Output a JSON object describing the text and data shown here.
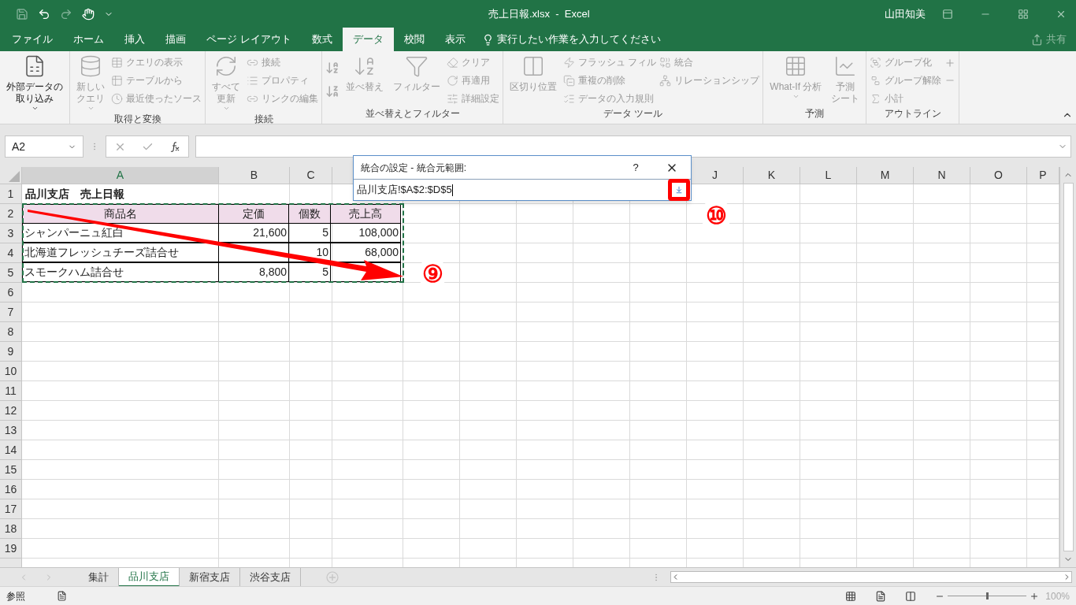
{
  "title_bar": {
    "title": "売上日報.xlsx  -  Excel",
    "user": "山田知美"
  },
  "tabs": [
    {
      "label": "ファイル",
      "selected": false
    },
    {
      "label": "ホーム",
      "selected": false
    },
    {
      "label": "挿入",
      "selected": false
    },
    {
      "label": "描画",
      "selected": false
    },
    {
      "label": "ページ レイアウト",
      "selected": false
    },
    {
      "label": "数式",
      "selected": false
    },
    {
      "label": "データ",
      "selected": true
    },
    {
      "label": "校閲",
      "selected": false
    },
    {
      "label": "表示",
      "selected": false
    }
  ],
  "tell_me": "実行したい作業を入力してください",
  "share": "共有",
  "ribbon_groups": [
    {
      "items": [
        {
          "kind": "large",
          "lines": [
            "外部データの",
            "取り込み"
          ],
          "disabled": false,
          "dropdown": true
        }
      ]
    },
    {
      "label": "取得と変換",
      "items": [
        {
          "kind": "large",
          "lines": [
            "新しい",
            "クエリ"
          ],
          "disabled": true,
          "dropdown": true
        },
        {
          "kind": "stack",
          "items": [
            {
              "label": "クエリの表示",
              "disabled": true
            },
            {
              "label": "テーブルから",
              "disabled": true
            },
            {
              "label": "最近使ったソース",
              "disabled": true
            }
          ]
        }
      ]
    },
    {
      "label": "接続",
      "items": [
        {
          "kind": "large",
          "lines": [
            "すべて",
            "更新"
          ],
          "disabled": true,
          "dropdown": true
        },
        {
          "kind": "stack",
          "items": [
            {
              "label": "接続",
              "disabled": true
            },
            {
              "label": "プロパティ",
              "disabled": true
            },
            {
              "label": "リンクの編集",
              "disabled": true
            }
          ]
        }
      ]
    },
    {
      "label": "並べ替えとフィルター",
      "items": [
        {
          "kind": "sort"
        },
        {
          "kind": "large",
          "lines": [
            "並べ替え"
          ],
          "disabled": true
        },
        {
          "kind": "large",
          "lines": [
            "フィルター"
          ],
          "disabled": true
        },
        {
          "kind": "stack",
          "items": [
            {
              "label": "クリア",
              "disabled": true
            },
            {
              "label": "再適用",
              "disabled": true
            },
            {
              "label": "詳細設定",
              "disabled": true
            }
          ]
        }
      ]
    },
    {
      "label": "データ ツール",
      "items": [
        {
          "kind": "large",
          "lines": [
            "区切り位置"
          ],
          "disabled": true
        },
        {
          "kind": "stack",
          "items": [
            {
              "label": "フラッシュ フィル",
              "disabled": true
            },
            {
              "label": "重複の削除",
              "disabled": true
            },
            {
              "label": "データの入力規則",
              "disabled": true
            }
          ]
        },
        {
          "kind": "stack",
          "items": [
            {
              "label": "統合",
              "disabled": true
            },
            {
              "label": "リレーションシップ",
              "disabled": true
            }
          ]
        }
      ]
    },
    {
      "label": "予測",
      "items": [
        {
          "kind": "large",
          "lines": [
            "What-If 分析"
          ],
          "disabled": true,
          "dropdown": true
        },
        {
          "kind": "large",
          "lines": [
            "予測",
            "シート"
          ],
          "disabled": true
        }
      ]
    },
    {
      "label": "アウトライン",
      "items": [
        {
          "kind": "stack",
          "items": [
            {
              "label": "グループ化",
              "disabled": true
            },
            {
              "label": "グループ解除",
              "disabled": true
            },
            {
              "label": "小計",
              "disabled": true
            }
          ]
        },
        {
          "kind": "outline"
        }
      ]
    }
  ],
  "name_box": "A2",
  "columns": [
    "A",
    "B",
    "C",
    "J",
    "K",
    "L",
    "M",
    "N",
    "O",
    "P"
  ],
  "rows": [
    {
      "number": "1",
      "cells": [
        {
          "kind": "title",
          "text": "品川支店　売上日報"
        }
      ]
    },
    {
      "number": "2",
      "cells": [
        {
          "kind": "header",
          "text": "商品名"
        },
        {
          "kind": "header",
          "text": "定価"
        },
        {
          "kind": "header",
          "text": "個数"
        },
        {
          "kind": "header",
          "text": "売上高"
        }
      ]
    },
    {
      "number": "3",
      "cells": [
        {
          "kind": "text",
          "text": "シャンパーニュ紅白"
        },
        {
          "kind": "number",
          "text": "21,600"
        },
        {
          "kind": "number",
          "text": "5"
        },
        {
          "kind": "number",
          "text": "108,000"
        }
      ]
    },
    {
      "number": "4",
      "cells": [
        {
          "kind": "text",
          "text": "北海道フレッシュチーズ詰合せ"
        },
        {
          "kind": "blank"
        },
        {
          "kind": "number",
          "text": "10"
        },
        {
          "kind": "number",
          "text": "68,000"
        }
      ]
    },
    {
      "number": "5",
      "cells": [
        {
          "kind": "text",
          "text": "スモークハム詰合せ"
        },
        {
          "kind": "number",
          "text": "8,800"
        },
        {
          "kind": "number",
          "text": "5"
        },
        {
          "kind": "blank"
        }
      ]
    },
    {
      "number": "6"
    },
    {
      "number": "7"
    },
    {
      "number": "8"
    },
    {
      "number": "9"
    },
    {
      "number": "10"
    },
    {
      "number": "11"
    },
    {
      "number": "12"
    },
    {
      "number": "13"
    },
    {
      "number": "14"
    },
    {
      "number": "15"
    },
    {
      "number": "16"
    },
    {
      "number": "17"
    },
    {
      "number": "18"
    },
    {
      "number": "19"
    }
  ],
  "dialog": {
    "title": "統合の設定 - 統合元範囲:",
    "help": "?",
    "value": "品川支店!$A$2:$D$5"
  },
  "annotations": [
    {
      "label": "⑨"
    },
    {
      "label": "⑩"
    }
  ],
  "sheet_tabs": [
    {
      "label": "集計",
      "selected": false
    },
    {
      "label": "品川支店",
      "selected": true
    },
    {
      "label": "新宿支店",
      "selected": false
    },
    {
      "label": "渋谷支店",
      "selected": false
    }
  ],
  "status": {
    "mode": "参照",
    "zoom": "100%",
    "zoom_slider": {
      "level": 0.5
    }
  }
}
